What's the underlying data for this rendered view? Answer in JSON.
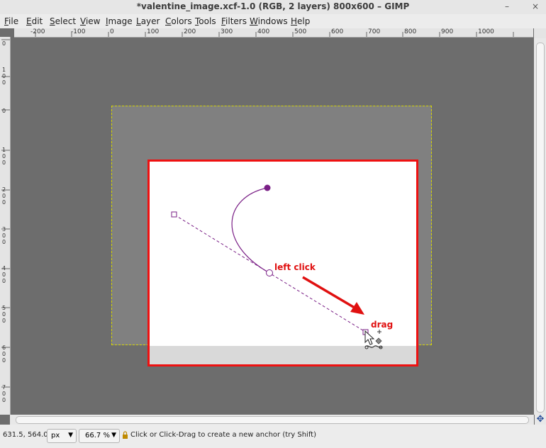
{
  "window": {
    "title": "*valentine_image.xcf-1.0 (RGB, 2 layers) 800x600 – GIMP",
    "minimize_glyph": "–",
    "close_glyph": "×"
  },
  "menu": {
    "items": [
      "File",
      "Edit",
      "Select",
      "View",
      "Image",
      "Layer",
      "Colors",
      "Tools",
      "Filters",
      "Windows",
      "Help"
    ]
  },
  "ruler": {
    "h_labels": [
      "-200",
      "-100",
      "0",
      "100",
      "200",
      "300",
      "400",
      "500",
      "600",
      "700",
      "800",
      "900",
      "1000"
    ],
    "v_labels": [
      "0",
      "100",
      "0",
      "100",
      "200",
      "300",
      "400",
      "500",
      "600",
      "700"
    ]
  },
  "canvas": {
    "annotation_left_click": "left click",
    "annotation_drag": "drag",
    "colors": {
      "highlight": "#ee1111",
      "path": "#7a1f86",
      "layer_boundary": "#d6d600"
    }
  },
  "status": {
    "coordinates": "631.5, 564.0",
    "unit": "px",
    "zoom": "66.7 %",
    "message": "Click or Click-Drag to create a new anchor (try Shift)"
  },
  "icons": {
    "nav": "navigate-icon",
    "lock": "lock-icon",
    "cursor": "pointer-cursor-icon"
  }
}
